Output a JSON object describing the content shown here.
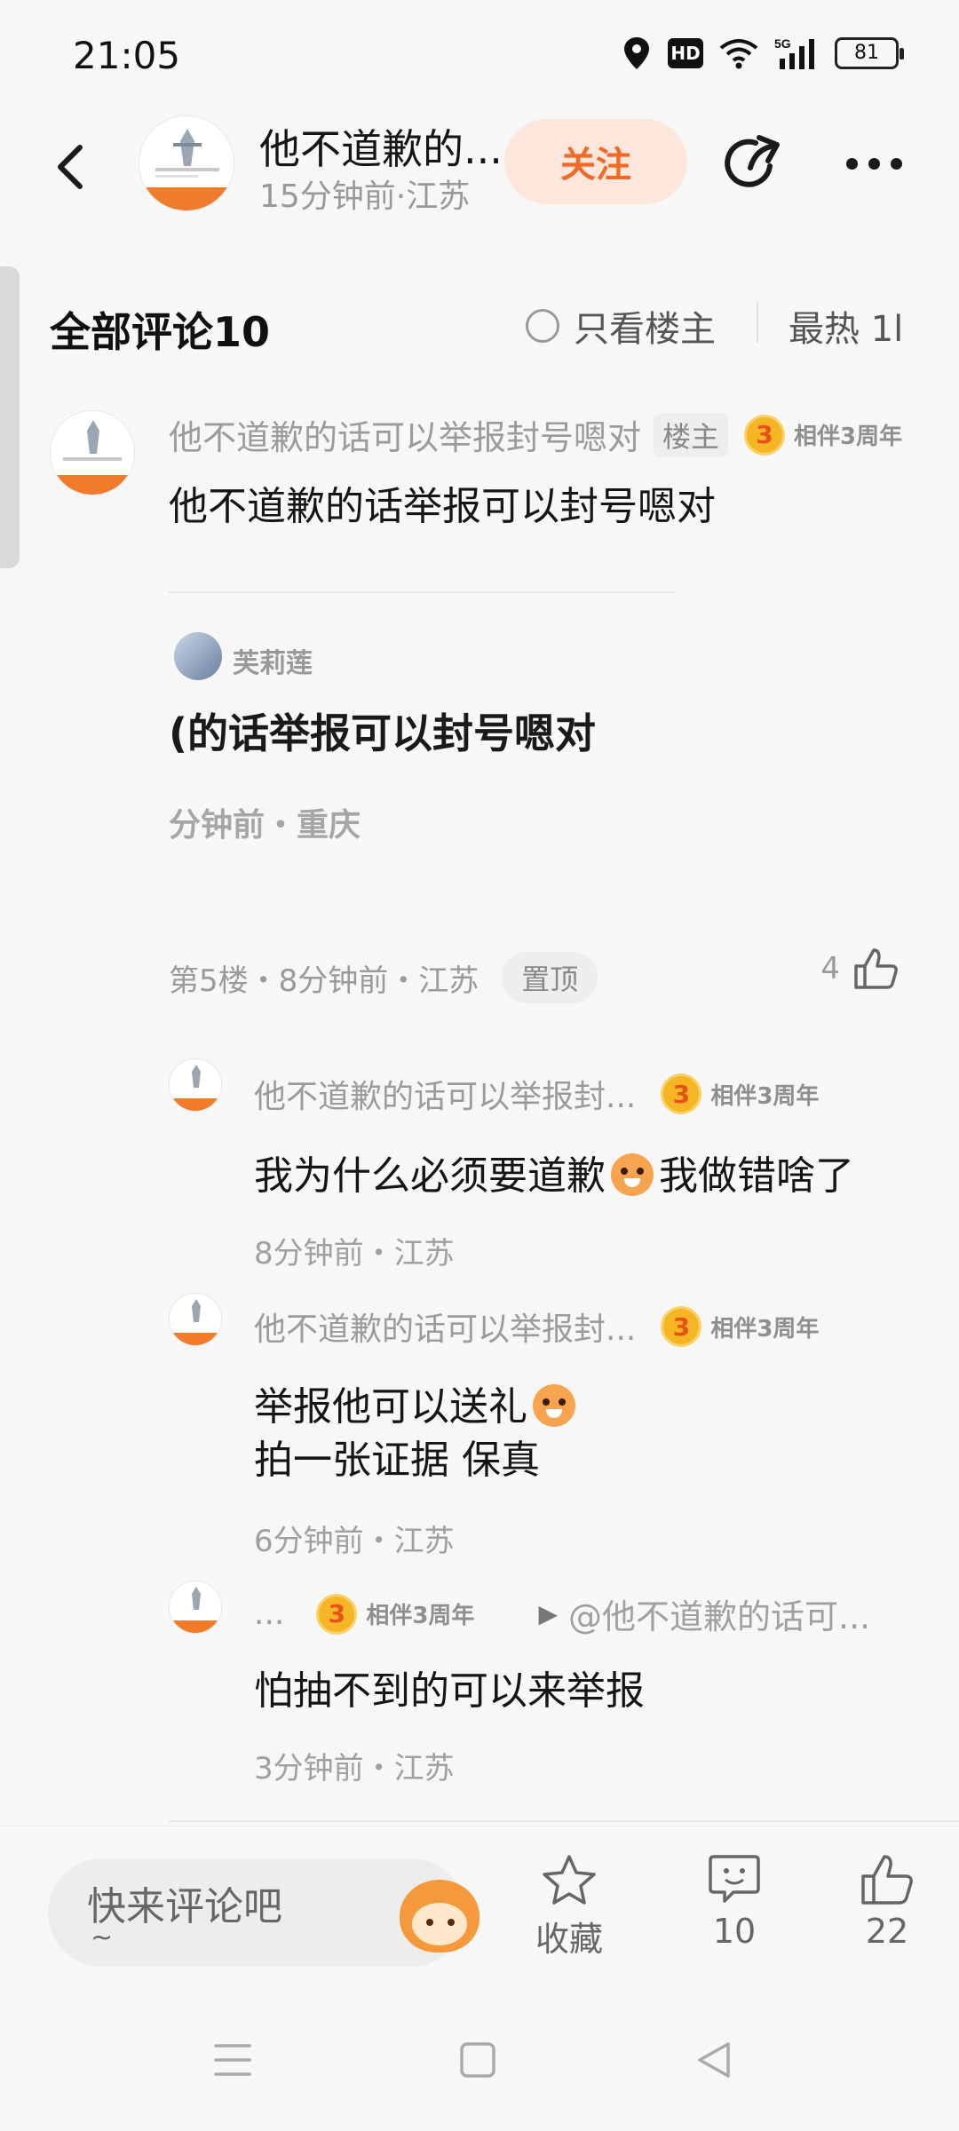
{
  "status_bar": {
    "time": "21:05",
    "hd": "HD",
    "network": "5G",
    "battery": "81"
  },
  "header": {
    "title": "他不道歉的...",
    "meta": "15分钟前·江苏",
    "follow_label": "关注"
  },
  "comments_bar": {
    "title": "全部评论10",
    "only_op_label": "只看楼主",
    "sort_label": "最热 1l"
  },
  "main_comment": {
    "author": "他不道歉的话可以举报封号嗯对",
    "op_tag": "楼主",
    "level": "3",
    "badge_text": "相伴3周年",
    "text": "他不道歉的话举报可以封号嗯对",
    "quote": {
      "name": "芙莉莲",
      "text": "(的话举报可以封号嗯对",
      "meta": "分钟前・重庆"
    },
    "floor_meta": "第5楼・8分钟前・江苏",
    "pin_tag": "置顶",
    "likes": "4"
  },
  "replies": [
    {
      "author": "他不道歉的话可以举报封...",
      "level": "3",
      "badge_text": "相伴3周年",
      "text_before": "我为什么必须要道歉",
      "text_after": "我做错啥了",
      "meta": "8分钟前・江苏"
    },
    {
      "author": "他不道歉的话可以举报封...",
      "level": "3",
      "badge_text": "相伴3周年",
      "line1": "举报他可以送礼",
      "line2": "拍一张证据  保真",
      "meta": "6分钟前・江苏"
    },
    {
      "author": "...",
      "level": "3",
      "badge_text": "相伴3周年",
      "reply_to": "@他不道歉的话可...",
      "text": "怕抽不到的可以来举报",
      "meta": "3分钟前・江苏"
    }
  ],
  "bottom_bar": {
    "input_placeholder": "快来评论吧",
    "input_tilde": "~",
    "favorite_label": "收藏",
    "comment_count": "10",
    "like_count": "22"
  },
  "colors": {
    "accent": "#f06a26",
    "follow_bg": "#fde7dc",
    "badge": "#f5b524"
  }
}
